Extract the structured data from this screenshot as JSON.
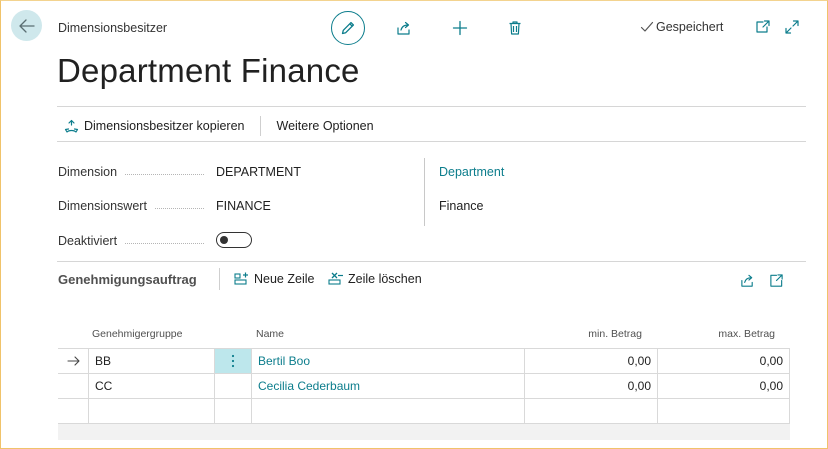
{
  "header": {
    "breadcrumb": "Dimensionsbesitzer",
    "saved_status": "Gespeichert",
    "title": "Department Finance"
  },
  "actions": {
    "copy_label": "Dimensionsbesitzer kopieren",
    "more_label": "Weitere Optionen"
  },
  "fields": {
    "dimension_label": "Dimension",
    "dimension_value": "DEPARTMENT",
    "dimension_name": "Department",
    "dimension_value_label": "Dimensionswert",
    "dimension_value_value": "FINANCE",
    "dimension_value_name": "Finance",
    "deactivated_label": "Deaktiviert",
    "deactivated": false
  },
  "subpage": {
    "title": "Genehmigungsauftrag",
    "new_line_label": "Neue Zeile",
    "delete_line_label": "Zeile löschen",
    "columns": {
      "group": "Genehmigergruppe",
      "name": "Name",
      "min": "min. Betrag",
      "max": "max. Betrag"
    },
    "rows": [
      {
        "group": "BB",
        "name": "Bertil Boo",
        "min": "0,00",
        "max": "0,00"
      },
      {
        "group": "CC",
        "name": "Cecilia Cederbaum",
        "min": "0,00",
        "max": "0,00"
      }
    ]
  },
  "colors": {
    "accent": "#0c7d8c",
    "back_button_bg": "#cfe8ec",
    "selected_cell_bg": "#bde7ec"
  }
}
